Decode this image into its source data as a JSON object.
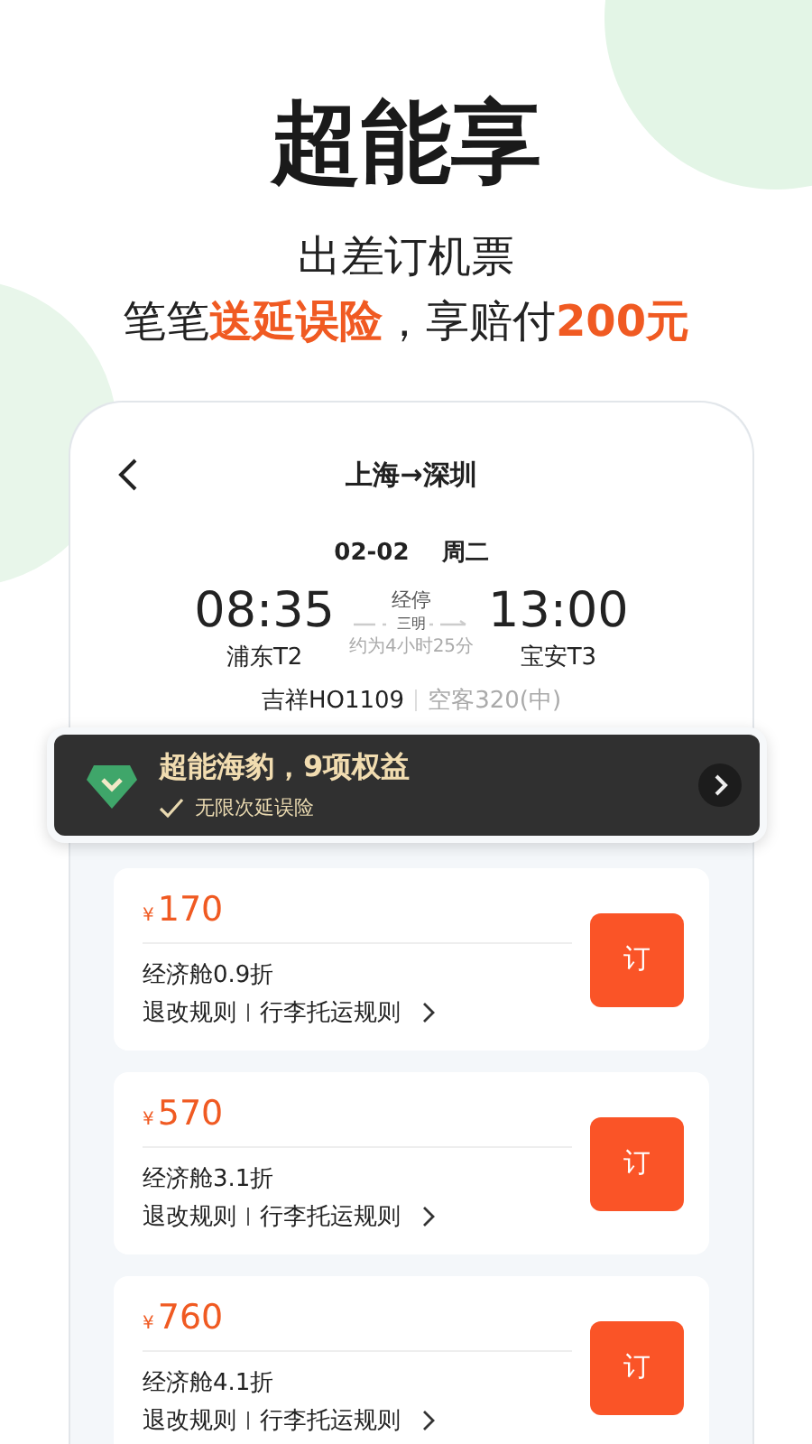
{
  "headline": "超能享",
  "subtitle_lines": [
    [
      {
        "text": "出差订机票",
        "highlight": false
      }
    ],
    [
      {
        "text": "笔笔",
        "highlight": false
      },
      {
        "text": "送延误险",
        "highlight": true
      },
      {
        "text": "，享赔付",
        "highlight": false
      },
      {
        "text": "200元",
        "highlight": true
      }
    ]
  ],
  "flight": {
    "route": "上海→深圳",
    "date": "02-02",
    "weekday": "周二",
    "depart_time": "08:35",
    "depart_airport": "浦东T2",
    "arrive_time": "13:00",
    "arrive_airport": "宝安T3",
    "stop_label": "经停",
    "stop_city": "三明",
    "duration": "约为4小时25分",
    "flight_no": "吉祥HO1109",
    "aircraft": "空客320(中)"
  },
  "banner": {
    "title": "超能海豹，9项权益",
    "benefit": "无限次延误险"
  },
  "fares": [
    {
      "currency": "¥",
      "price": "170",
      "cabin": "经济舱0.9折",
      "rule_1": "退改规则",
      "rule_2": "行李托运规则",
      "book": "订"
    },
    {
      "currency": "¥",
      "price": "570",
      "cabin": "经济舱3.1折",
      "rule_1": "退改规则",
      "rule_2": "行李托运规则",
      "book": "订"
    },
    {
      "currency": "¥",
      "price": "760",
      "cabin": "经济舱4.1折",
      "rule_1": "退改规则",
      "rule_2": "行李托运规则",
      "book": "订"
    }
  ]
}
